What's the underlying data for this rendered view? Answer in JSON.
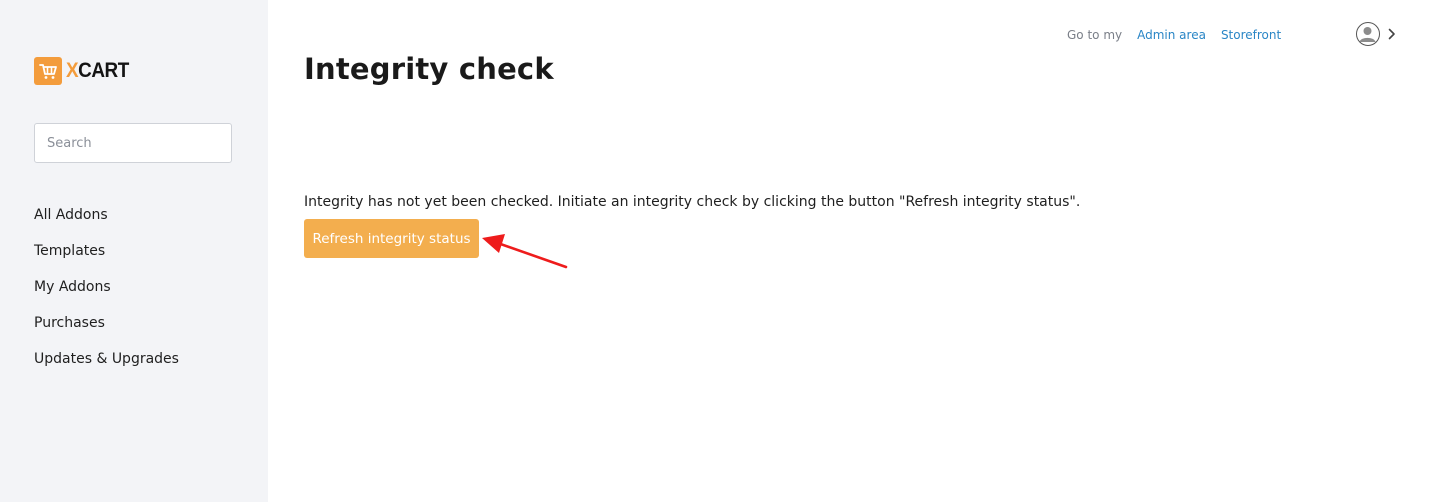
{
  "sidebar": {
    "logo": {
      "x_letter": "X",
      "text_rest": "CART"
    },
    "search": {
      "placeholder": "Search",
      "value": ""
    },
    "items": [
      {
        "label": "All Addons"
      },
      {
        "label": "Templates"
      },
      {
        "label": "My Addons"
      },
      {
        "label": "Purchases"
      },
      {
        "label": "Updates & Upgrades"
      }
    ]
  },
  "topbar": {
    "goto_label": "Go to my",
    "admin_link": "Admin area",
    "storefront_link": "Storefront",
    "avatar_icon": "user-avatar-icon",
    "chevron_icon": "chevron-right-icon"
  },
  "main": {
    "title": "Integrity check",
    "message": "Integrity has not yet been checked. Initiate an integrity check by clicking the button \"Refresh integrity status\".",
    "refresh_button": "Refresh integrity status"
  },
  "colors": {
    "brand": "#f39c3c",
    "button": "#f3ae4e",
    "link": "#2a86c6",
    "sidebar_bg": "#f3f4f7",
    "annotation_arrow": "#ee1c1c"
  }
}
